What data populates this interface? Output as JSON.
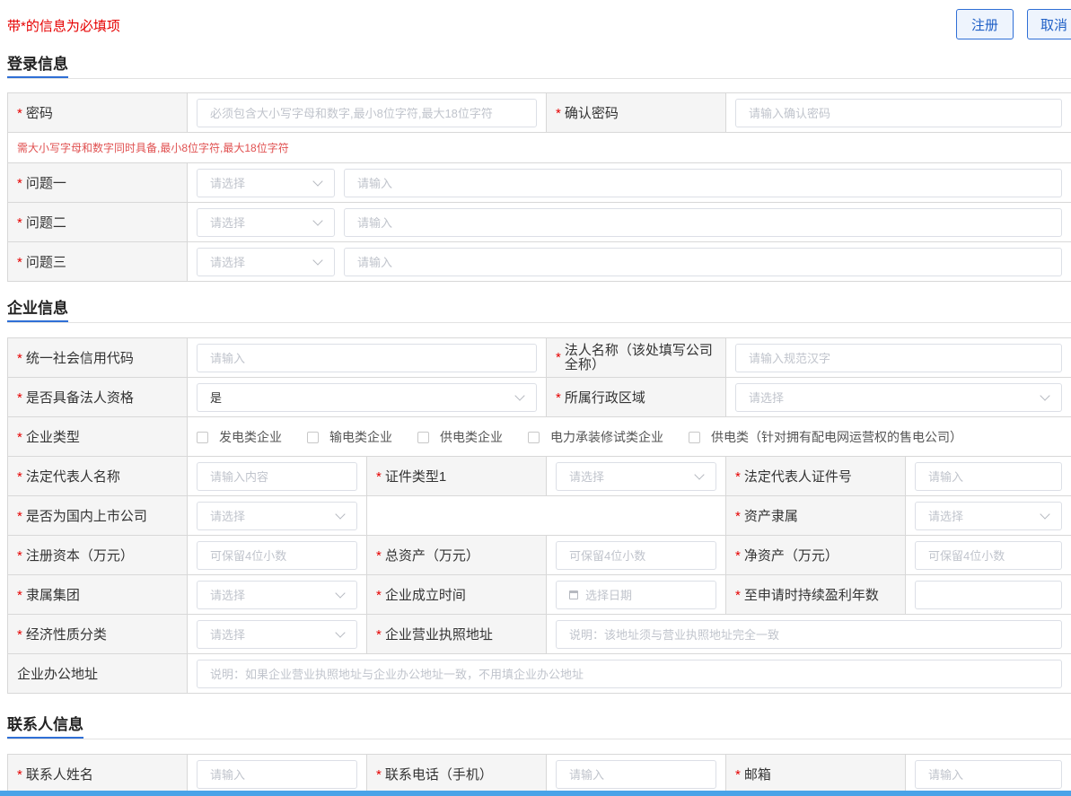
{
  "header": {
    "required_note": "带*的信息为必填项",
    "register_label": "注册",
    "cancel_label": "取消"
  },
  "sections": {
    "login": "登录信息",
    "company": "企业信息",
    "contact": "联系人信息"
  },
  "login": {
    "password_label": "密码",
    "password_placeholder": "必须包含大小写字母和数字,最小8位字符,最大18位字符",
    "confirm_label": "确认密码",
    "confirm_placeholder": "请输入确认密码",
    "password_hint": "需大小写字母和数字同时具备,最小8位字符,最大18位字符",
    "q1_label": "问题一",
    "q2_label": "问题二",
    "q3_label": "问题三",
    "select_placeholder": "请选择",
    "input_placeholder": "请输入"
  },
  "company": {
    "credit_code_label": "统一社会信用代码",
    "credit_code_placeholder": "请输入",
    "legal_name_label": "法人名称（该处填写公司全称）",
    "legal_name_placeholder": "请输入规范汉字",
    "has_legal_label": "是否具备法人资格",
    "has_legal_value": "是",
    "region_label": "所属行政区域",
    "region_placeholder": "请选择",
    "type_label": "企业类型",
    "type_options": [
      "发电类企业",
      "输电类企业",
      "供电类企业",
      "电力承装修试类企业",
      "供电类（针对拥有配电网运营权的售电公司）"
    ],
    "rep_name_label": "法定代表人名称",
    "rep_name_placeholder": "请输入内容",
    "cert_type_label": "证件类型1",
    "cert_type_placeholder": "请选择",
    "rep_id_label": "法定代表人证件号",
    "rep_id_placeholder": "请输入",
    "listed_label": "是否为国内上市公司",
    "listed_placeholder": "请选择",
    "asset_owner_label": "资产隶属",
    "asset_owner_placeholder": "请选择",
    "reg_capital_label": "注册资本（万元）",
    "reg_capital_placeholder": "可保留4位小数",
    "total_assets_label": "总资产（万元）",
    "total_assets_placeholder": "可保留4位小数",
    "net_assets_label": "净资产（万元）",
    "net_assets_placeholder": "可保留4位小数",
    "group_label": "隶属集团",
    "group_placeholder": "请选择",
    "founded_label": "企业成立时间",
    "founded_placeholder": "选择日期",
    "profit_years_label": "至申请时持续盈利年数",
    "econ_label": "经济性质分类",
    "econ_placeholder": "请选择",
    "license_addr_label": "企业营业执照地址",
    "license_addr_placeholder": "说明：该地址须与营业执照地址完全一致",
    "office_addr_label": "企业办公地址",
    "office_addr_placeholder": "说明：如果企业营业执照地址与企业办公地址一致，不用填企业办公地址"
  },
  "contact": {
    "name_label": "联系人姓名",
    "name_placeholder": "请输入",
    "phone_label": "联系电话（手机）",
    "phone_placeholder": "请输入",
    "email_label": "邮箱",
    "email_placeholder": "请输入"
  }
}
